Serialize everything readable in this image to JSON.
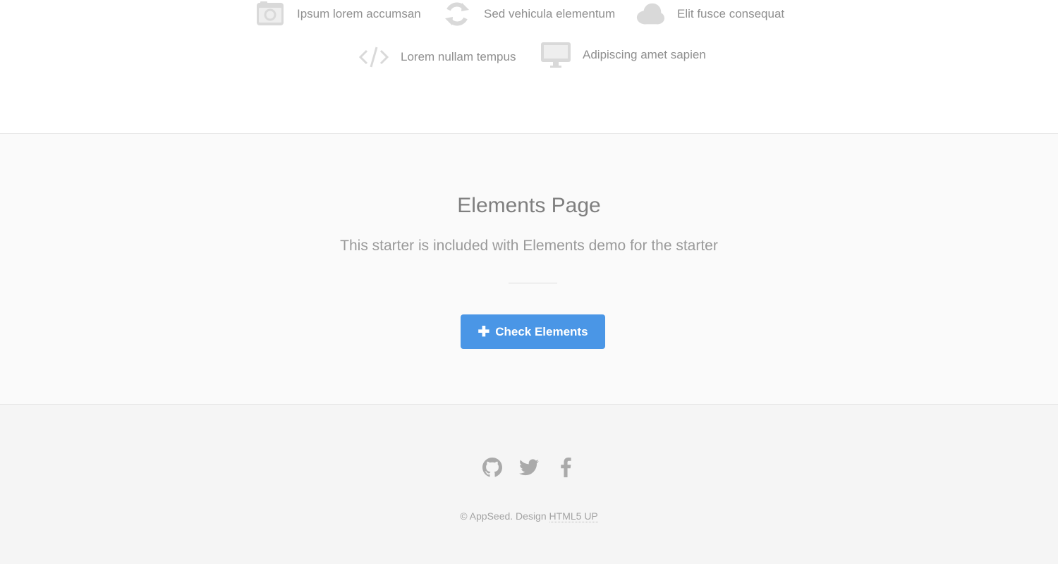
{
  "features": {
    "row1": [
      {
        "label": "Ipsum lorem accumsan",
        "icon": "camera-icon"
      },
      {
        "label": "Sed vehicula elementum",
        "icon": "refresh-icon"
      },
      {
        "label": "Elit fusce consequat",
        "icon": "cloud-icon"
      }
    ],
    "row2": [
      {
        "label": "Lorem nullam tempus",
        "icon": "code-icon"
      },
      {
        "label": "Adipiscing amet sapien",
        "icon": "desktop-icon"
      }
    ],
    "icon_color": "#d9d9d9"
  },
  "cta": {
    "title": "Elements Page",
    "subtitle": "This starter is included with Elements demo for the starter",
    "button_label": "Check Elements",
    "button_color": "#4a96e6"
  },
  "footer": {
    "social": [
      {
        "icon": "github-icon"
      },
      {
        "icon": "twitter-icon"
      },
      {
        "icon": "facebook-icon"
      }
    ],
    "copyright_prefix": "© AppSeed. Design",
    "copyright_link": "HTML5 UP"
  }
}
